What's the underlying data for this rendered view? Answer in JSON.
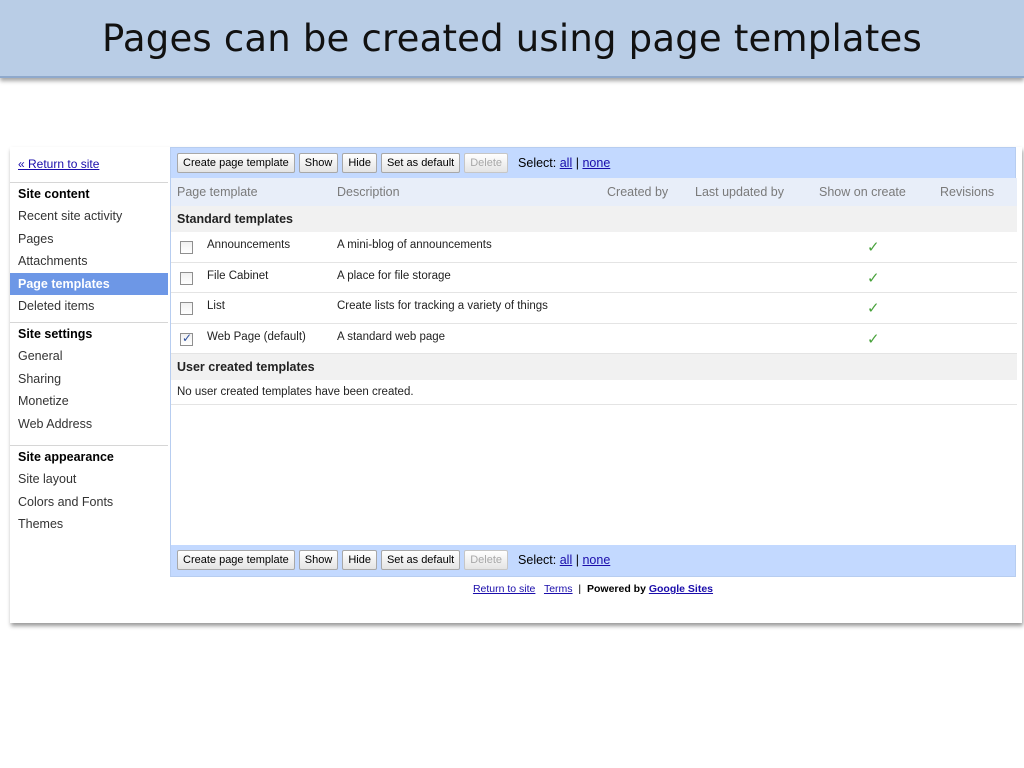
{
  "slide": {
    "title": "Pages can be created using page templates"
  },
  "sidebar": {
    "return_link": "« Return to site",
    "sections": [
      {
        "heading": "Site content",
        "items": [
          "Recent site activity",
          "Pages",
          "Attachments",
          "Page templates",
          "Deleted items"
        ],
        "active": "Page templates"
      },
      {
        "heading": "Site settings",
        "items": [
          "General",
          "Sharing",
          "Monetize",
          "Web Address"
        ]
      },
      {
        "heading": "Site appearance",
        "items": [
          "Site layout",
          "Colors and Fonts",
          "Themes"
        ]
      }
    ]
  },
  "toolbar": {
    "create_label": "Create page template",
    "show_label": "Show",
    "hide_label": "Hide",
    "default_label": "Set as default",
    "delete_label": "Delete",
    "select_label": "Select:",
    "select_all": "all",
    "select_sep": "|",
    "select_none": "none"
  },
  "table": {
    "columns": [
      "Page template",
      "Description",
      "Created by",
      "Last updated by",
      "Show on create",
      "Revisions"
    ],
    "standard_group": "Standard templates",
    "standard_rows": [
      {
        "name": "Announcements",
        "description": "A mini-blog of announcements",
        "checked": false,
        "show_on_create": true
      },
      {
        "name": "File Cabinet",
        "description": "A place for file storage",
        "checked": false,
        "show_on_create": true
      },
      {
        "name": "List",
        "description": "Create lists for tracking a variety of things",
        "checked": false,
        "show_on_create": true
      },
      {
        "name": "Web Page (default)",
        "description": "A standard web page",
        "checked": true,
        "show_on_create": true
      }
    ],
    "user_group": "User created templates",
    "user_empty": "No user created templates have been created."
  },
  "footer": {
    "return_link": "Return to site",
    "terms_link": "Terms",
    "sep": "|",
    "powered_by": "Powered by",
    "google_sites": "Google Sites"
  },
  "colors": {
    "title_bar": "#b9cde6",
    "panel": "#c3d9ff",
    "active_nav": "#6d97e6",
    "check": "#4aa33d"
  },
  "icons": {
    "show_on_create": "checkmark-icon",
    "checkbox": "checkbox-icon"
  }
}
